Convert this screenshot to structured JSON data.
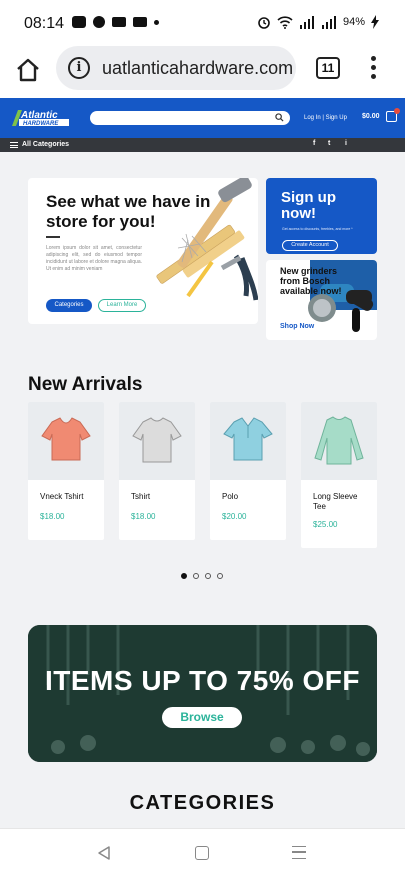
{
  "status_bar": {
    "time": "08:14",
    "battery": "94%"
  },
  "browser": {
    "url": "uatlanticahardware.com",
    "tab_count": "11"
  },
  "site_header": {
    "logo_line1": "Atlantic",
    "logo_line2": "HARDWARE",
    "login_signup": "Log In | Sign Up",
    "cart_total": "$0.00",
    "colors": {
      "brand_blue": "#1558c6",
      "accent_green": "#2bb39a"
    }
  },
  "category_bar": {
    "label": "All Categories",
    "social": [
      "f",
      "t",
      "i"
    ]
  },
  "hero": {
    "title": "See what we have in store for you!",
    "body": "Lorem ipsum dolor sit amet, consectetur adipiscing elit, sed do eiusmod tempor incididunt ut labore et dolore magna aliqua. Ut enim ad minim veniam",
    "categories_button": "Categories",
    "learn_more_button": "Learn More"
  },
  "signup_card": {
    "title": "Sign up now!",
    "subtitle": "Get access to discounts, freebies, and more *",
    "button": "Create Account"
  },
  "grinder_card": {
    "title": "New grinders from Bosch available now!",
    "link": "Shop Now"
  },
  "new_arrivals": {
    "title": "New Arrivals",
    "products": [
      {
        "name": "Vneck Tshirt",
        "price": "$18.00",
        "color": "#f08a72"
      },
      {
        "name": "Tshirt",
        "price": "$18.00",
        "color": "#dcdcdc"
      },
      {
        "name": "Polo",
        "price": "$20.00",
        "color": "#8fd0e0"
      },
      {
        "name": "Long Sleeve Tee",
        "price": "$25.00",
        "color": "#a6dcc8"
      }
    ],
    "carousel_pages": 4,
    "active_page": 1
  },
  "promo": {
    "title": "ITEMS UP TO 75% OFF",
    "button": "Browse"
  },
  "categories": {
    "title": "CATEGORIES"
  }
}
